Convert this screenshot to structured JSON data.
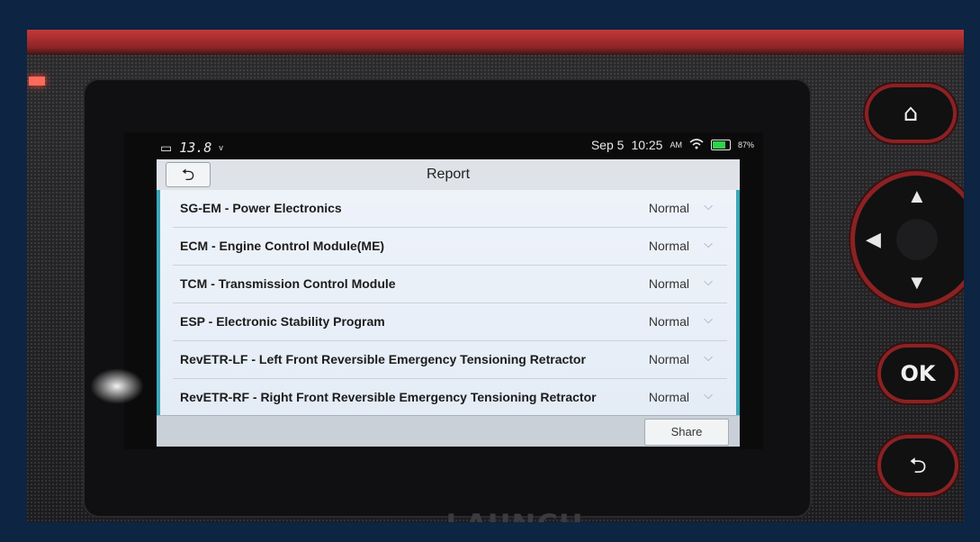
{
  "device": {
    "brand": "LAUNCH",
    "buttons": {
      "ok_label": "OK"
    }
  },
  "status_bar": {
    "voltage": "13.8",
    "voltage_unit": "v",
    "date": "Sep 5",
    "time": "10:25",
    "am_pm": "AM",
    "battery": "87%"
  },
  "header": {
    "title": "Report"
  },
  "report": {
    "rows": [
      {
        "module": "SG-EM - Power Electronics",
        "status": "Normal"
      },
      {
        "module": "ECM - Engine Control Module(ME)",
        "status": "Normal"
      },
      {
        "module": "TCM - Transmission Control Module",
        "status": "Normal"
      },
      {
        "module": "ESP - Electronic Stability Program",
        "status": "Normal"
      },
      {
        "module": "RevETR-LF - Left Front Reversible Emergency Tensioning Retractor",
        "status": "Normal"
      },
      {
        "module": "RevETR-RF - Right Front Reversible Emergency Tensioning Retractor",
        "status": "Normal"
      }
    ]
  },
  "footer": {
    "share_label": "Share"
  },
  "icons": {
    "back": "back-arrow-icon",
    "home": "home-icon",
    "wifi": "wifi-icon",
    "battery": "battery-icon",
    "chevron": "chevron-down-icon"
  },
  "colors": {
    "accent": "#3aa8b8",
    "device_red": "#c4393a",
    "battery_green": "#2fd24a"
  }
}
